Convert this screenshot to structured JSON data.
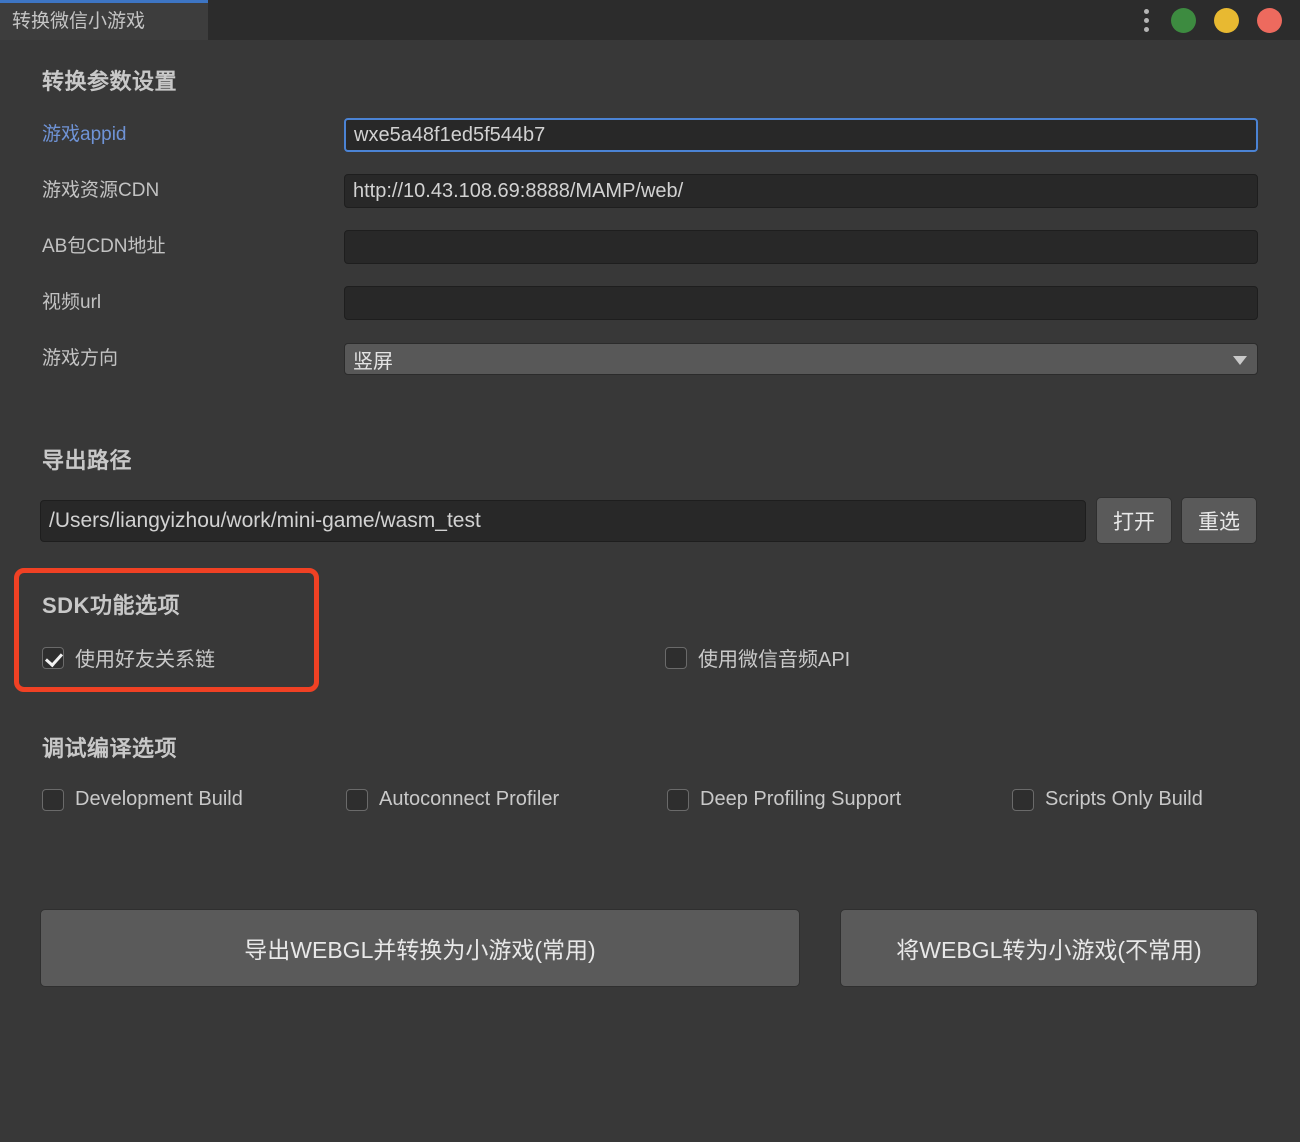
{
  "window": {
    "tab_title": "转换微信小游戏",
    "menu_icon": "kebab-menu-icon",
    "controls": [
      {
        "name": "minimize",
        "color": "#3d8b40"
      },
      {
        "name": "maximize",
        "color": "#e8b931"
      },
      {
        "name": "close",
        "color": "#ed6a5e"
      }
    ]
  },
  "params_section": {
    "title": "转换参数设置",
    "fields": [
      {
        "label": "游戏appid",
        "value": "wxe5a48f1ed5f544b7",
        "placeholder": "",
        "focused": true,
        "accent": true
      },
      {
        "label": "游戏资源CDN",
        "value": "http://10.43.108.69:8888/MAMP/web/",
        "placeholder": "",
        "focused": false,
        "accent": false
      },
      {
        "label": "AB包CDN地址",
        "value": "",
        "placeholder": "",
        "focused": false,
        "accent": false
      },
      {
        "label": "视频url",
        "value": "",
        "placeholder": "",
        "focused": false,
        "accent": false
      }
    ],
    "orientation": {
      "label": "游戏方向",
      "selected": "竖屏",
      "caret_icon": "chevron-down-icon"
    }
  },
  "export_section": {
    "title": "导出路径",
    "path": "/Users/liangyizhou/work/mini-game/wasm_test",
    "open_button": "打开",
    "reselect_button": "重选"
  },
  "sdk_section": {
    "title": "SDK功能选项",
    "highlight_color": "#f04124",
    "options": [
      {
        "label": "使用好友关系链",
        "checked": true
      },
      {
        "label": "使用微信音频API",
        "checked": false
      }
    ]
  },
  "debug_section": {
    "title": "调试编译选项",
    "options": [
      {
        "label": "Development Build",
        "checked": false
      },
      {
        "label": "Autoconnect Profiler",
        "checked": false
      },
      {
        "label": "Deep Profiling Support",
        "checked": false
      },
      {
        "label": "Scripts Only Build",
        "checked": false
      }
    ]
  },
  "actions": {
    "primary": "导出WEBGL并转换为小游戏(常用)",
    "secondary": "将WEBGL转为小游戏(不常用)"
  }
}
